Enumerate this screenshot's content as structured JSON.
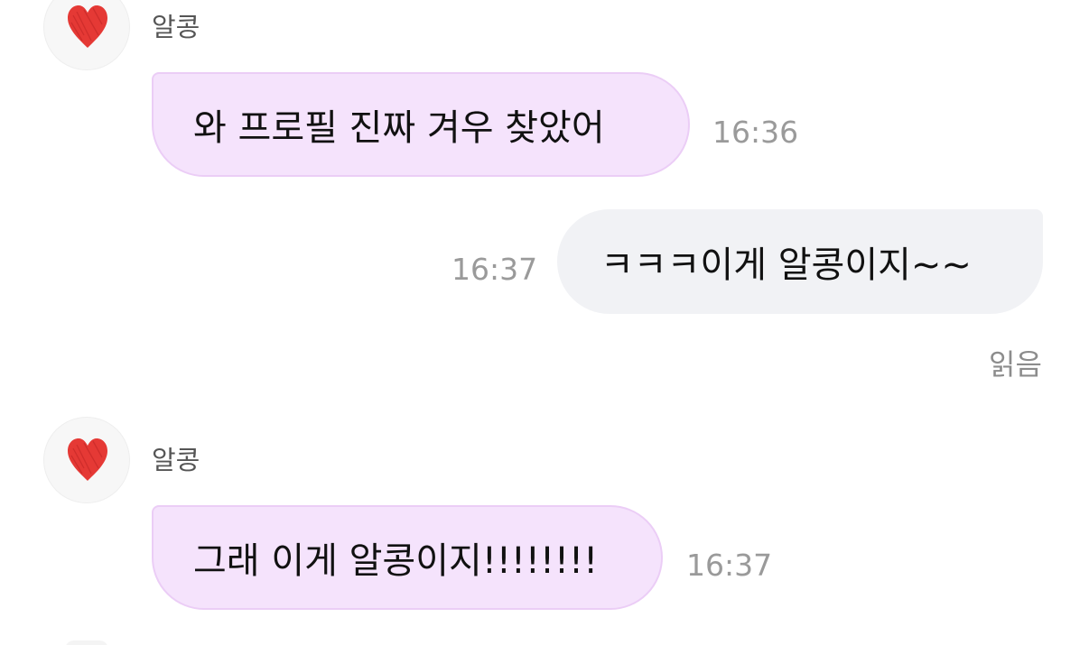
{
  "messages": [
    {
      "sender": "알콩",
      "avatar": "red-heart-icon",
      "text": "와 프로필 진짜 겨우 찾았어",
      "time": "16:36",
      "direction": "incoming"
    },
    {
      "text": "ㅋㅋㅋ이게 알콩이지~~",
      "time": "16:37",
      "direction": "outgoing",
      "status": "읽음"
    },
    {
      "sender": "알콩",
      "avatar": "red-heart-icon",
      "text": "그래 이게 알콩이지!!!!!!!!",
      "time": "16:37",
      "direction": "incoming"
    }
  ],
  "colors": {
    "incoming_bubble": "#f5e3fc",
    "outgoing_bubble": "#f1f2f5",
    "heart": "#e53935",
    "timestamp": "#9a9a9a"
  }
}
